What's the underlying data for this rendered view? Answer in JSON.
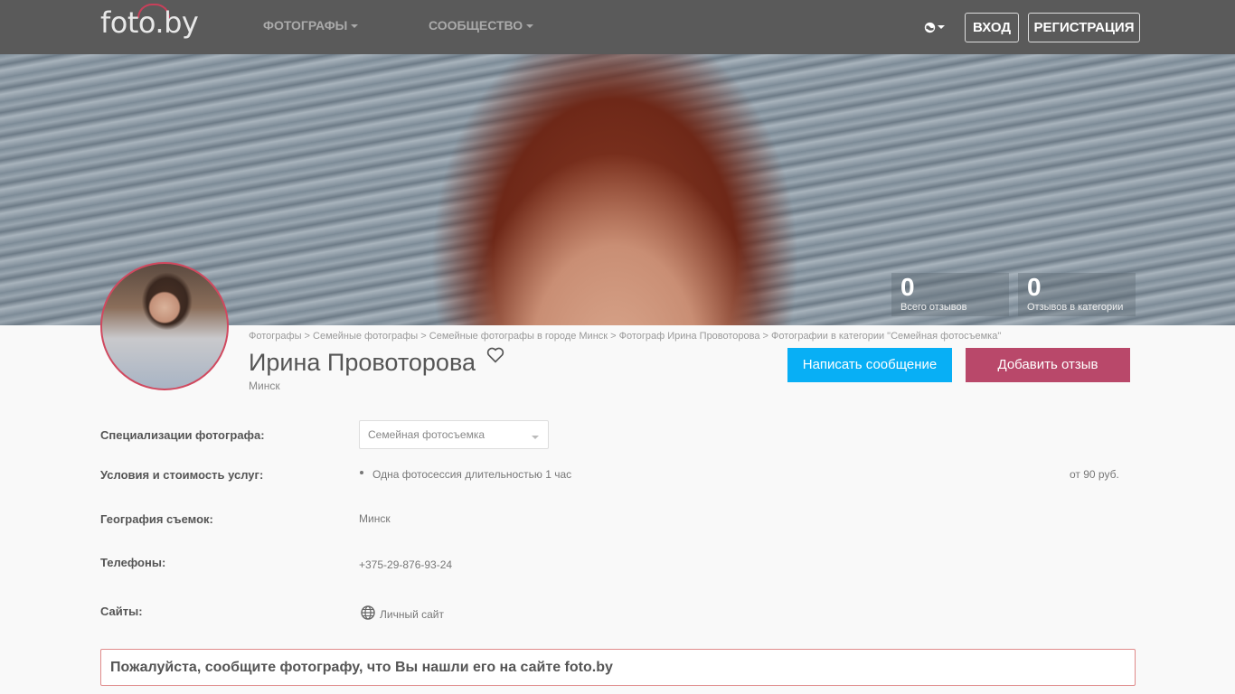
{
  "header": {
    "logo": "foto.by",
    "nav": [
      {
        "label": "ФОТОГРАФЫ"
      },
      {
        "label": "СООБЩЕСТВО"
      }
    ],
    "login": "ВХОД",
    "register": "РЕГИСТРАЦИЯ"
  },
  "stats": [
    {
      "value": "0",
      "label": "Всего отзывов"
    },
    {
      "value": "0",
      "label": "Отзывов в категории"
    }
  ],
  "breadcrumb": "Фотографы > Семейные фотографы > Семейные фотографы в городе Минск > Фотограф Ирина Провоторова > Фотографии в категории \"Семейная фотосъемка\"",
  "profile": {
    "name": "Ирина Провоторова",
    "city": "Минск"
  },
  "actions": {
    "message": "Написать сообщение",
    "review": "Добавить отзыв"
  },
  "info": {
    "spec_label": "Специализации фотографа:",
    "spec_value": "Семейная фотосъемка",
    "terms_label": "Условия и стоимость услуг:",
    "terms_item": "Одна фотосессия длительностью 1 час",
    "terms_price": "от 90 руб.",
    "geo_label": "География съемок:",
    "geo_value": "Минск",
    "phones_label": "Телефоны:",
    "phones_value": "+375-29-876-93-24",
    "sites_label": "Сайты:",
    "sites_value": "Личный сайт"
  },
  "notice": "Пожалуйста, сообщите фотографу, что Вы нашли его на сайте foto.by",
  "colors": {
    "topbar": "#5a5a5a",
    "primary_blue": "#08aff5",
    "accent_red": "#b9486a"
  }
}
